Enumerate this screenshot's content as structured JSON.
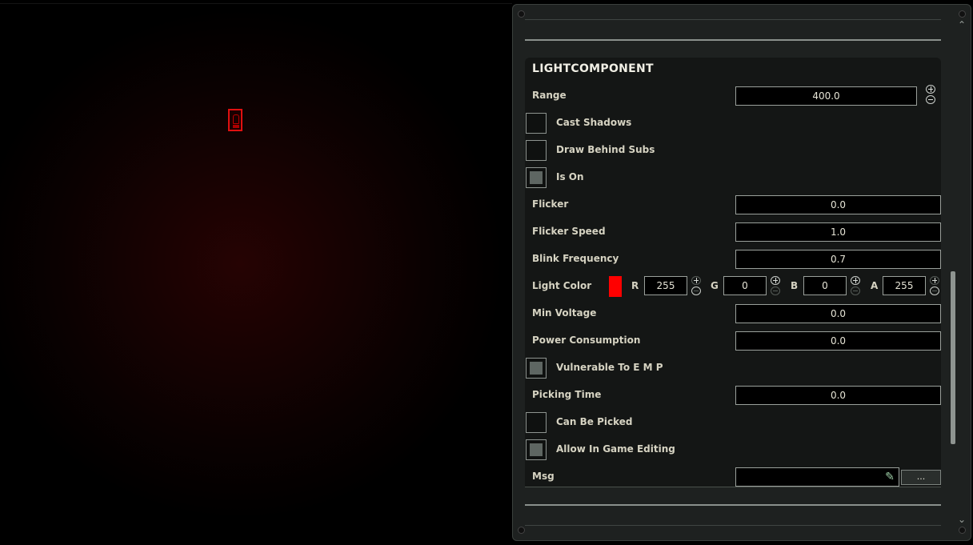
{
  "component": {
    "title": "LIGHTCOMPONENT",
    "range": {
      "label": "Range",
      "value": "400.0"
    },
    "cast_shadows": {
      "label": "Cast Shadows",
      "checked": false
    },
    "draw_behind_subs": {
      "label": "Draw Behind Subs",
      "checked": false
    },
    "is_on": {
      "label": "Is On",
      "checked": true
    },
    "flicker": {
      "label": "Flicker",
      "value": "0.0"
    },
    "flicker_speed": {
      "label": "Flicker Speed",
      "value": "1.0"
    },
    "blink_frequency": {
      "label": "Blink Frequency",
      "value": "0.7"
    },
    "light_color": {
      "label": "Light Color",
      "swatch": "#ff0000",
      "r": {
        "label": "R",
        "value": "255"
      },
      "g": {
        "label": "G",
        "value": "0"
      },
      "b": {
        "label": "B",
        "value": "0"
      },
      "a": {
        "label": "A",
        "value": "255"
      }
    },
    "min_voltage": {
      "label": "Min Voltage",
      "value": "0.0"
    },
    "power_consumption": {
      "label": "Power Consumption",
      "value": "0.0"
    },
    "vulnerable_to_emp": {
      "label": "Vulnerable To E M P",
      "checked": true
    },
    "picking_time": {
      "label": "Picking Time",
      "value": "0.0"
    },
    "can_be_picked": {
      "label": "Can Be Picked",
      "checked": false
    },
    "allow_in_game_editing": {
      "label": "Allow In Game Editing",
      "checked": true
    },
    "msg": {
      "label": "Msg",
      "value": "",
      "more_label": "..."
    }
  },
  "icons": {
    "scroll_up": "chevron-up-icon",
    "scroll_down": "chevron-down-icon",
    "edit": "pencil-icon",
    "increment": "plus-circle-icon",
    "decrement": "minus-circle-icon"
  },
  "colors": {
    "accent_red": "#ff0000",
    "panel_bg": "#141615"
  }
}
